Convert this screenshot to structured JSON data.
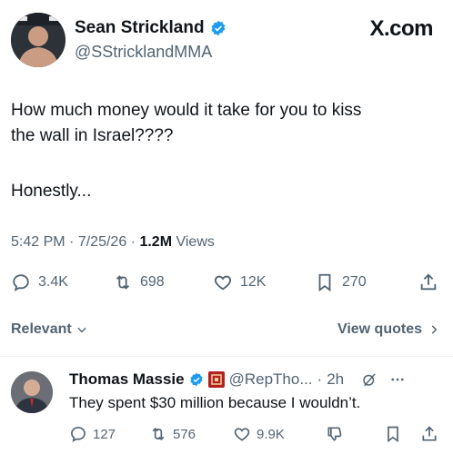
{
  "header": {
    "display_name": "Sean Strickland",
    "handle": "@SStricklandMMA",
    "site": "X.com"
  },
  "tweet": {
    "text_line1": "How much money would it take for you to kiss",
    "text_line2": "the wall in Israel????",
    "text_line3": "Honestly...",
    "time": "5:42 PM",
    "date": "7/25/26",
    "views_count": "1.2M",
    "views_label": "Views",
    "sep": "·"
  },
  "actions": {
    "replies": "3.4K",
    "reposts": "698",
    "likes": "12K",
    "bookmarks": "270"
  },
  "filter": {
    "relevant_label": "Relevant",
    "view_quotes_label": "View quotes"
  },
  "reply": {
    "display_name": "Thomas Massie",
    "handle": "@RepTho...",
    "time": "2h",
    "sep": "·",
    "text": "They spent $30 million because I wouldn’t.",
    "replies": "127",
    "reposts": "576",
    "likes": "9.9K"
  },
  "colors": {
    "verified_blue": "#1d9bf0",
    "secondary_text": "#536471",
    "primary_text": "#0f1419"
  }
}
